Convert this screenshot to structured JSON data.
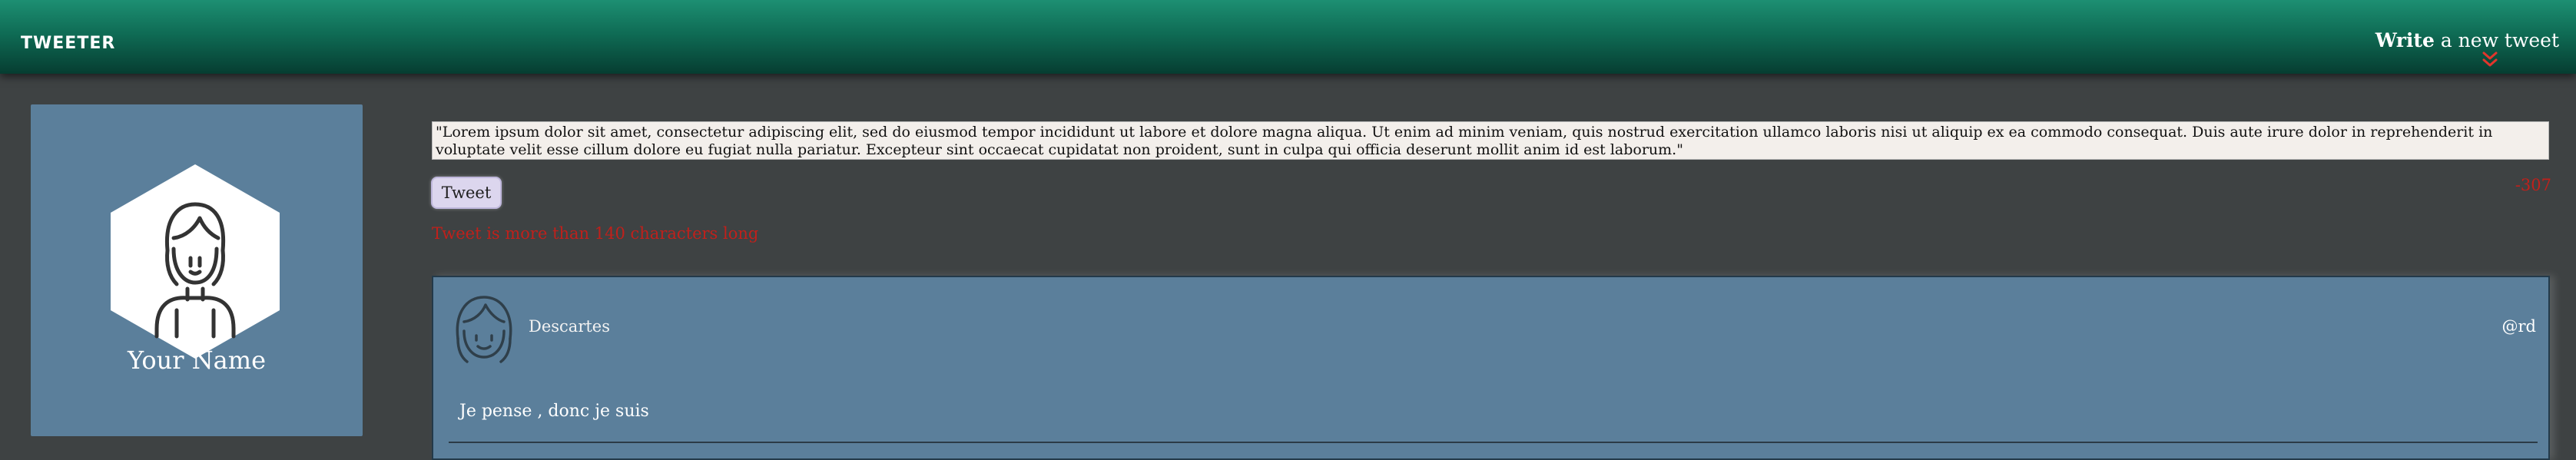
{
  "navbar": {
    "brand": "TWEETER",
    "compose_bold": "Write",
    "compose_rest": " a new tweet",
    "chevron_icon": "double-chevron-down-icon",
    "accent_color": "#d32f2f"
  },
  "profile": {
    "name": "Your Name",
    "avatar_icon": "user-avatar-icon",
    "card_color": "#5b7f9b"
  },
  "composer": {
    "text": "\"Lorem ipsum dolor sit amet, consectetur adipiscing elit, sed do eiusmod tempor incididunt ut labore et dolore magna aliqua. Ut enim ad minim veniam, quis nostrud exercitation ullamco laboris nisi ut aliquip ex ea commodo consequat. Duis aute irure dolor in reprehenderit in voluptate velit esse cillum dolore eu fugiat nulla pariatur. Excepteur sint occaecat cupidatat non proident, sunt in culpa qui officia deserunt mollit anim id est laborum.\"",
    "button_label": "Tweet",
    "char_counter": "-307",
    "error_message": "Tweet is more than 140 characters long",
    "error_color": "#c0201b"
  },
  "tweets": [
    {
      "author": "Descartes",
      "handle": "@rd",
      "text": "Je pense , donc je suis",
      "avatar_icon": "user-avatar-icon"
    }
  ]
}
